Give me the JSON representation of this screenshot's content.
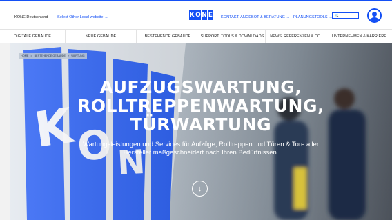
{
  "header": {
    "site_name": "KONE Deutschland",
    "other_site": "Select Other Local website →",
    "logo_letters": [
      "K",
      "O",
      "N",
      "E"
    ],
    "kontakt": "KONTAKT, ANGEBOT & BERATUNG →",
    "planung": "PLANUNGSTOOLS →",
    "search": {
      "value": "",
      "placeholder": "🔍"
    },
    "accent_color": "#1450f5"
  },
  "nav": {
    "items": [
      {
        "label": "DIGITALE GEBÄUDE"
      },
      {
        "label": "NEUE GEBÄUDE"
      },
      {
        "label": "BESTEHENDE GEBÄUDE"
      },
      {
        "label": "SUPPORT, TOOLS & DOWNLOADS"
      },
      {
        "label": "NEWS, REFERENZEN & CO."
      },
      {
        "label": "UNTERNEHMEN & KARRIERE"
      }
    ]
  },
  "hero": {
    "breadcrumb": [
      "HOME",
      "BESTEHENDE GEBÄUDE",
      "WARTUNG"
    ],
    "breadcrumb_sep": ">",
    "title_lines": [
      "AUFZUGSWARTUNG,",
      "ROLLTREPPENWARTUNG,",
      "TÜRWARTUNG"
    ],
    "subtitle_lines": [
      "Wartungsleistungen und Services für Aufzüge, Rolltreppen und Türen & Tore aller",
      "Hersteller maßgeschneidert nach Ihren Bedürfnissen."
    ],
    "scroll_icon": "arrow-down-icon",
    "scroll_glyph": "↓"
  }
}
